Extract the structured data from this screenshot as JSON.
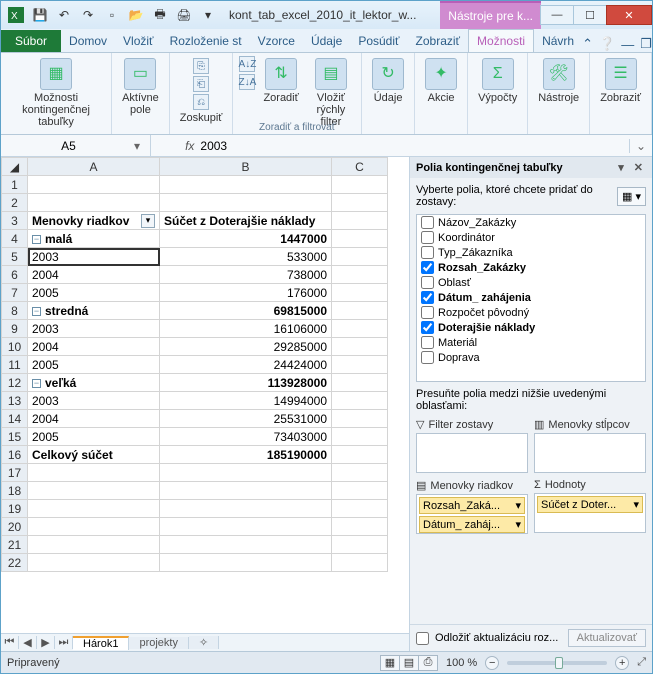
{
  "title": "kont_tab_excel_2010_it_lektor_w...",
  "contextual_tab_group": "Nástroje pre k...",
  "tabs": {
    "file": "Súbor",
    "home": "Domov",
    "insert": "Vložiť",
    "layout": "Rozloženie st",
    "formulas": "Vzorce",
    "data": "Údaje",
    "review": "Posúdiť",
    "view": "Zobraziť",
    "options": "Možnosti",
    "design": "Návrh"
  },
  "ribbon": {
    "pivot_options": "Možnosti\nkontingenčnej tabuľky",
    "active_field": "Aktívne\npole",
    "group": "Zoskupiť",
    "sort_asc": "A↓Z",
    "sort_desc": "Z↓A",
    "sort": "Zoradiť",
    "insert_slicer": "Vložiť rýchly\nfilter",
    "sort_filter_group": "Zoradiť a filtrovať",
    "data": "Údaje",
    "actions": "Akcie",
    "calc": "Výpočty",
    "tools": "Nástroje",
    "show": "Zobraziť"
  },
  "name_box": "A5",
  "formula": "2003",
  "columns": [
    "A",
    "B",
    "C"
  ],
  "pivot": {
    "row_label_hdr": "Menovky riadkov",
    "value_hdr": "Súčet z Doterajšie náklady",
    "groups": [
      {
        "name": "malá",
        "total": 1447000,
        "rows": [
          [
            "2003",
            533000
          ],
          [
            "2004",
            738000
          ],
          [
            "2005",
            176000
          ]
        ]
      },
      {
        "name": "stredná",
        "total": 69815000,
        "rows": [
          [
            "2003",
            16106000
          ],
          [
            "2004",
            29285000
          ],
          [
            "2005",
            24424000
          ]
        ]
      },
      {
        "name": "veľká",
        "total": 113928000,
        "rows": [
          [
            "2003",
            14994000
          ],
          [
            "2004",
            25531000
          ],
          [
            "2005",
            73403000
          ]
        ]
      }
    ],
    "grand_label": "Celkový súčet",
    "grand_total": 185190000
  },
  "tabs_sheet": {
    "active": "Hárok1",
    "other": "projekty"
  },
  "pane": {
    "title": "Polia kontingenčnej tabuľky",
    "prompt": "Vyberte polia, ktoré chcete pridať do zostavy:",
    "fields": [
      {
        "name": "Názov_Zakázky",
        "checked": false
      },
      {
        "name": "Koordinátor",
        "checked": false
      },
      {
        "name": "Typ_Zákazníka",
        "checked": false
      },
      {
        "name": "Rozsah_Zakázky",
        "checked": true
      },
      {
        "name": "Oblasť",
        "checked": false
      },
      {
        "name": "Dátum_ zahájenia",
        "checked": true
      },
      {
        "name": "Rozpočet pôvodný",
        "checked": false
      },
      {
        "name": "Doterajšie náklady",
        "checked": true
      },
      {
        "name": "Materiál",
        "checked": false
      },
      {
        "name": "Doprava",
        "checked": false
      }
    ],
    "drag_prompt": "Presuňte polia medzi nižšie uvedenými oblasťami:",
    "area_filter": "Filter zostavy",
    "area_cols": "Menovky stĺpcov",
    "area_rows": "Menovky riadkov",
    "area_vals": "Hodnoty",
    "row_items": [
      "Rozsah_Zaká...",
      "Dátum_ zaháj..."
    ],
    "val_items": [
      "Súčet z Doter..."
    ],
    "defer": "Odložiť aktualizáciu roz...",
    "update": "Aktualizovať"
  },
  "status": {
    "ready": "Pripravený",
    "zoom": "100 %"
  }
}
